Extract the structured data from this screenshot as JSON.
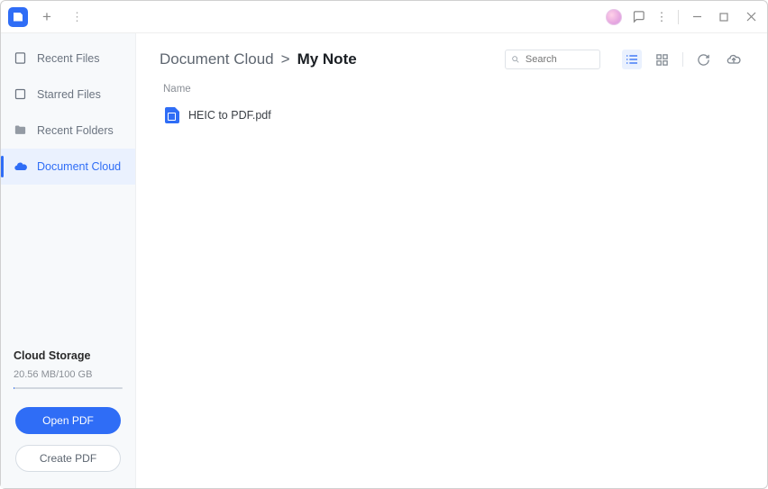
{
  "sidebar": {
    "items": [
      {
        "label": "Recent Files"
      },
      {
        "label": "Starred Files"
      },
      {
        "label": "Recent Folders"
      },
      {
        "label": "Document Cloud"
      }
    ],
    "storage_title": "Cloud Storage",
    "storage_value": "20.56 MB/100 GB",
    "open_pdf_label": "Open PDF",
    "create_pdf_label": "Create PDF"
  },
  "breadcrumb": {
    "root": "Document Cloud",
    "sep": ">",
    "current": "My Note"
  },
  "search": {
    "placeholder": "Search"
  },
  "list": {
    "name_header": "Name",
    "files": [
      {
        "name": "HEIC to PDF.pdf"
      }
    ]
  }
}
